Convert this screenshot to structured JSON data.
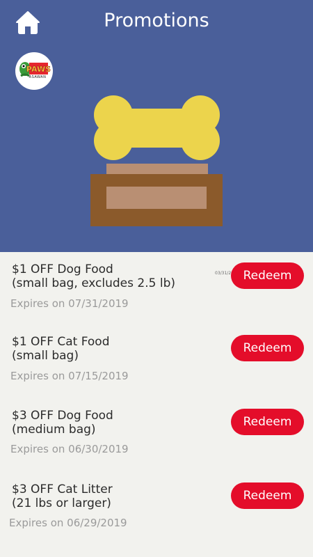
{
  "header": {
    "title": "Promotions",
    "background": "#4a5f9a",
    "home_icon": "home-icon",
    "logo_alt": "PAWS ASAWAN",
    "logo_text": "ASAWAN"
  },
  "hero": {
    "icon": "bone-on-pedestal-icon",
    "bone_color": "#ecd44c",
    "pedestal_color": "#8b5a2b"
  },
  "promotions": [
    {
      "title": "$1 OFF Dog Food\n(small bag, excludes 2.5 lb)",
      "expires": "Expires on 07/31/2019",
      "button": "Redeem"
    },
    {
      "title": "$1 OFF Cat Food\n(small bag)",
      "expires": "Expires on 07/15/2019",
      "button": "Redeem"
    },
    {
      "title": "$3 OFF Dog Food\n(medium bag)",
      "expires": "Expires on 06/30/2019",
      "button": "Redeem"
    },
    {
      "title": "$3 OFF Cat Litter\n(21 lbs or larger)",
      "expires": "Expires on 06/29/2019",
      "button": "Redeem"
    }
  ],
  "overlay_date": "03/31/2019",
  "colors": {
    "redeem": "#e40d2a",
    "list_bg": "#f2f2ee"
  }
}
